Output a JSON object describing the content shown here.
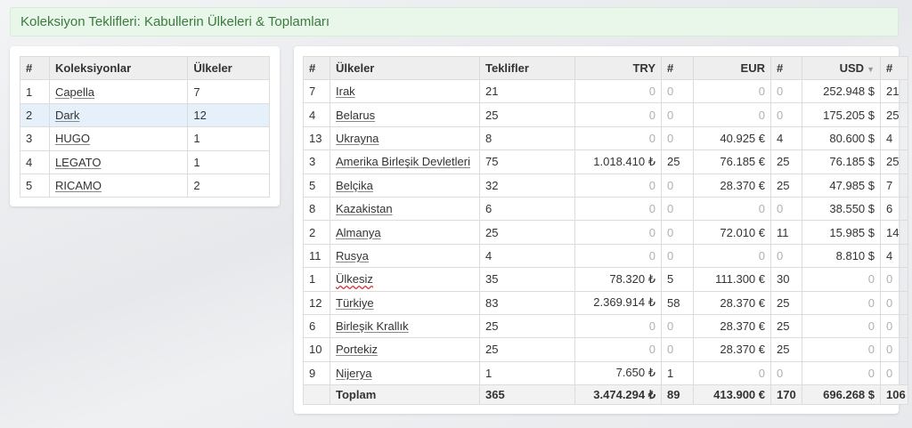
{
  "header": {
    "title": "Koleksiyon Teklifleri: Kabullerin Ülkeleri & Toplamları"
  },
  "collections": {
    "headers": [
      "#",
      "Koleksiyonlar",
      "Ülkeler"
    ],
    "rows": [
      {
        "n": "1",
        "name": "Capella",
        "count": "7"
      },
      {
        "n": "2",
        "name": "Dark",
        "count": "12"
      },
      {
        "n": "3",
        "name": "HUGO",
        "count": "1"
      },
      {
        "n": "4",
        "name": "LEGATO",
        "count": "1"
      },
      {
        "n": "5",
        "name": "RICAMO",
        "count": "2"
      }
    ],
    "highlighted_row": 1
  },
  "countries": {
    "headers": [
      "#",
      "Ülkeler",
      "Teklifler",
      "TRY",
      "#",
      "EUR",
      "#",
      "USD",
      "#"
    ],
    "sort_icon": "sort-down-icon",
    "rows": [
      {
        "n": "7",
        "country": "Irak",
        "offers": "21",
        "try": "0",
        "try_n": "0",
        "eur": "0",
        "eur_n": "0",
        "usd": "252.948 $",
        "usd_n": "21"
      },
      {
        "n": "4",
        "country": "Belarus",
        "offers": "25",
        "try": "0",
        "try_n": "0",
        "eur": "0",
        "eur_n": "0",
        "usd": "175.205 $",
        "usd_n": "25"
      },
      {
        "n": "13",
        "country": "Ukrayna",
        "offers": "8",
        "try": "0",
        "try_n": "0",
        "eur": "40.925 €",
        "eur_n": "4",
        "usd": "80.600 $",
        "usd_n": "4"
      },
      {
        "n": "3",
        "country": "Amerika Birleşik Devletleri",
        "offers": "75",
        "try": "1.018.410 ₺",
        "try_n": "25",
        "eur": "76.185 €",
        "eur_n": "25",
        "usd": "76.185 $",
        "usd_n": "25"
      },
      {
        "n": "5",
        "country": "Belçika",
        "offers": "32",
        "try": "0",
        "try_n": "0",
        "eur": "28.370 €",
        "eur_n": "25",
        "usd": "47.985 $",
        "usd_n": "7"
      },
      {
        "n": "8",
        "country": "Kazakistan",
        "offers": "6",
        "try": "0",
        "try_n": "0",
        "eur": "0",
        "eur_n": "0",
        "usd": "38.550 $",
        "usd_n": "6"
      },
      {
        "n": "2",
        "country": "Almanya",
        "offers": "25",
        "try": "0",
        "try_n": "0",
        "eur": "72.010 €",
        "eur_n": "11",
        "usd": "15.985 $",
        "usd_n": "14"
      },
      {
        "n": "11",
        "country": "Rusya",
        "offers": "4",
        "try": "0",
        "try_n": "0",
        "eur": "0",
        "eur_n": "0",
        "usd": "8.810 $",
        "usd_n": "4"
      },
      {
        "n": "1",
        "country": "Ülkesiz",
        "offers": "35",
        "try": "78.320 ₺",
        "try_n": "5",
        "eur": "111.300 €",
        "eur_n": "30",
        "usd": "0",
        "usd_n": "0"
      },
      {
        "n": "12",
        "country": "Türkiye",
        "offers": "83",
        "try": "2.369.914 ₺",
        "try_n": "58",
        "eur": "28.370 €",
        "eur_n": "25",
        "usd": "0",
        "usd_n": "0"
      },
      {
        "n": "6",
        "country": "Birleşik Krallık",
        "offers": "25",
        "try": "0",
        "try_n": "0",
        "eur": "28.370 €",
        "eur_n": "25",
        "usd": "0",
        "usd_n": "0"
      },
      {
        "n": "10",
        "country": "Portekiz",
        "offers": "25",
        "try": "0",
        "try_n": "0",
        "eur": "28.370 €",
        "eur_n": "25",
        "usd": "0",
        "usd_n": "0"
      },
      {
        "n": "9",
        "country": "Nijerya",
        "offers": "1",
        "try": "7.650 ₺",
        "try_n": "1",
        "eur": "0",
        "eur_n": "0",
        "usd": "0",
        "usd_n": "0"
      }
    ],
    "total": {
      "label": "Toplam",
      "offers": "365",
      "try": "3.474.294 ₺",
      "try_n": "89",
      "eur": "413.900 €",
      "eur_n": "170",
      "usd": "696.268 $",
      "usd_n": "106"
    }
  }
}
